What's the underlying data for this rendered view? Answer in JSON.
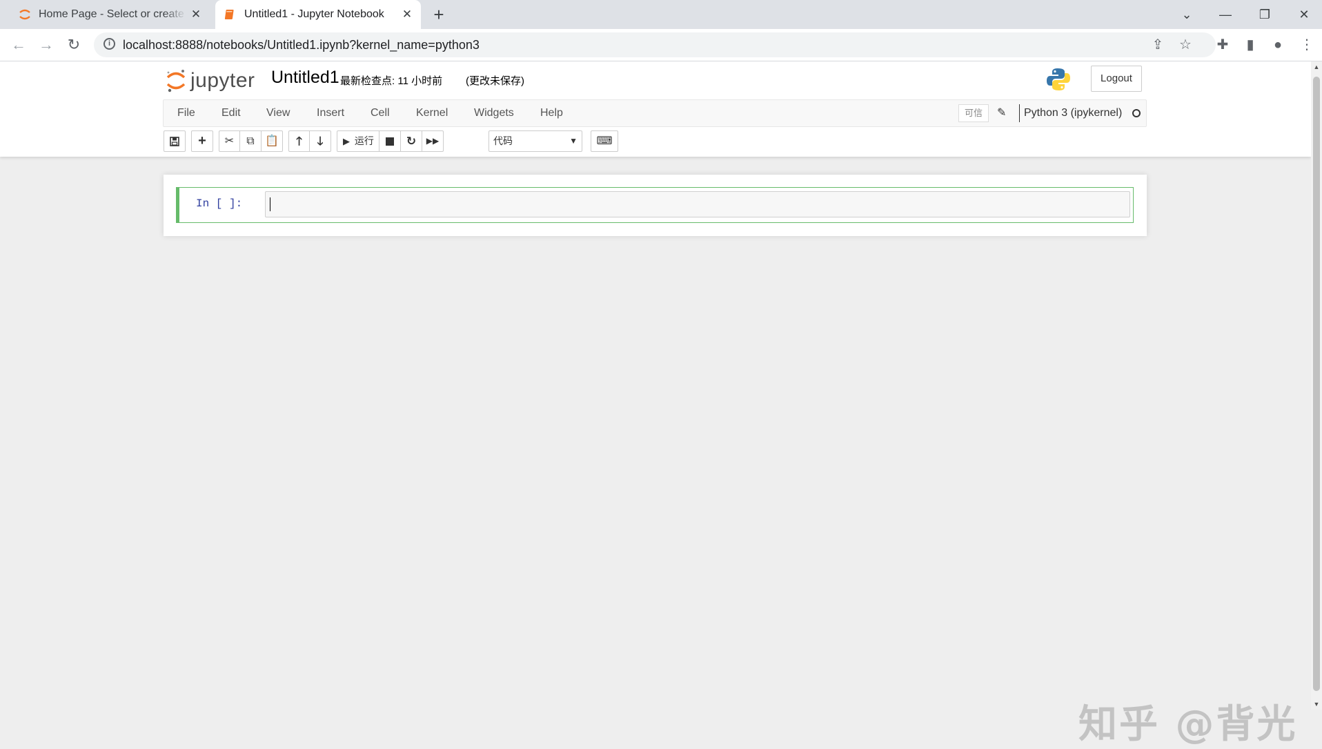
{
  "browser": {
    "tabs": [
      {
        "title": "Home Page - Select or create a notebook",
        "active": false
      },
      {
        "title": "Untitled1 - Jupyter Notebook",
        "active": true
      }
    ],
    "new_tab": "+",
    "url": "localhost:8888/notebooks/Untitled1.ipynb?kernel_name=python3",
    "window_controls": {
      "dropdown": "⌄",
      "minimize": "—",
      "restore": "❐",
      "close": "✕"
    }
  },
  "header": {
    "logo_text": "jupyter",
    "notebook_name": "Untitled1",
    "checkpoint": "最新检查点: 11 小时前",
    "autosave": "(更改未保存)",
    "logout": "Logout"
  },
  "menu": {
    "items": [
      "File",
      "Edit",
      "View",
      "Insert",
      "Cell",
      "Kernel",
      "Widgets",
      "Help"
    ],
    "trusted": "可信",
    "kernel_name": "Python 3 (ipykernel)"
  },
  "toolbar": {
    "run_label": "运行",
    "cell_type": "代码"
  },
  "cell": {
    "prompt": "In [ ]:",
    "source": ""
  },
  "watermark": "知乎 @背光",
  "colors": {
    "cell_border": "#66bb6a",
    "jupyter_orange": "#f37726",
    "prompt_blue": "#303f9f"
  }
}
